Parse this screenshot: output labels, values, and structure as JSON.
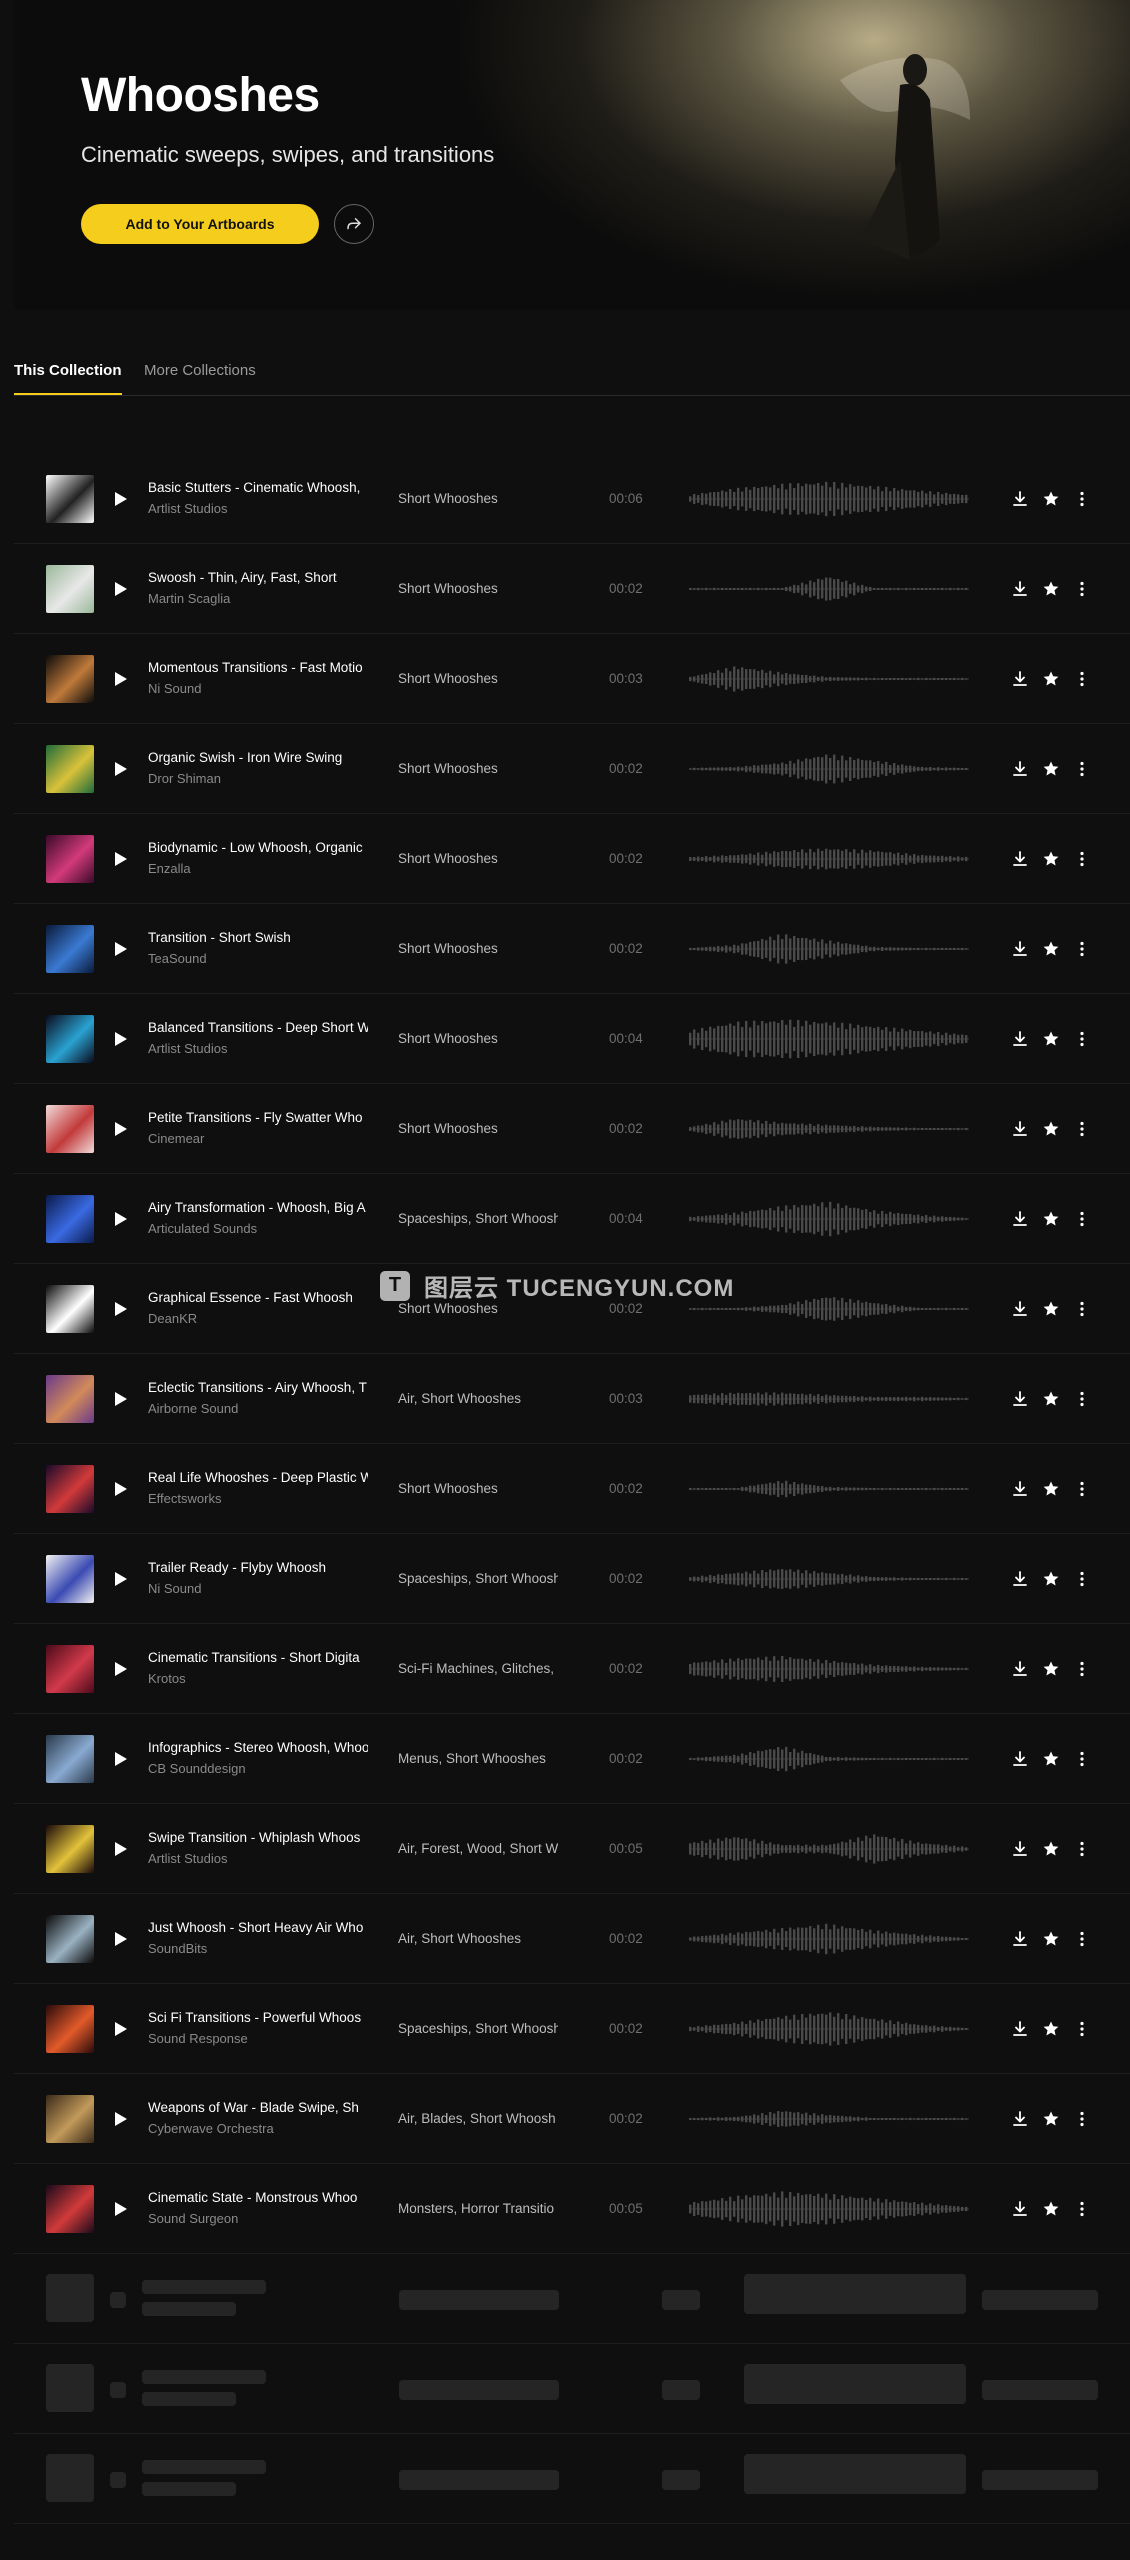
{
  "hero": {
    "title": "Whooshes",
    "subtitle": "Cinematic sweeps, swipes, and transitions",
    "add_button": "Add to Your Artboards",
    "share_icon": "share-icon"
  },
  "tabs": [
    {
      "label": "This Collection",
      "active": true
    },
    {
      "label": "More Collections",
      "active": false
    }
  ],
  "colors": {
    "accent": "#f5cd1d",
    "background": "#0f0f10"
  },
  "watermark": {
    "text": "图层云  TUCENGYUN.COM"
  },
  "tracks": [
    {
      "title": "Basic Stutters - Cinematic Whoosh, ",
      "artist": "Artlist Studios",
      "tags": "Short Whooshes",
      "duration": "00:06",
      "thumb": [
        "#ffffff",
        "#222222"
      ],
      "wave": [
        0.2,
        0.5,
        0.7,
        0.8,
        0.6,
        0.4,
        0.2
      ]
    },
    {
      "title": "Swoosh - Thin, Airy, Fast, Short",
      "artist": "Martin Scaglia",
      "tags": "Short Whooshes",
      "duration": "00:02",
      "thumb": [
        "#9ab79a",
        "#e8e8e8"
      ],
      "wave": [
        0.05,
        0.05,
        0.05,
        0.6,
        0.05,
        0.05,
        0.05
      ]
    },
    {
      "title": "Momentous Transitions - Fast Motio",
      "artist": "Ni Sound",
      "tags": "Short Whooshes",
      "duration": "00:03",
      "thumb": [
        "#0b0b0b",
        "#c07a3a"
      ],
      "wave": [
        0.1,
        0.6,
        0.3,
        0.1,
        0.05,
        0.05,
        0.05
      ]
    },
    {
      "title": "Organic Swish - Iron Wire Swing",
      "artist": "Dror Shiman",
      "tags": "Short Whooshes",
      "duration": "00:02",
      "thumb": [
        "#1f6b3a",
        "#d9c23a"
      ],
      "wave": [
        0.05,
        0.1,
        0.3,
        0.7,
        0.4,
        0.1,
        0.05
      ]
    },
    {
      "title": "Biodynamic - Low Whoosh, Organic",
      "artist": "Enzalla",
      "tags": "Short Whooshes",
      "duration": "00:02",
      "thumb": [
        "#3a0a2a",
        "#d23a7a"
      ],
      "wave": [
        0.1,
        0.2,
        0.4,
        0.5,
        0.4,
        0.2,
        0.1
      ]
    },
    {
      "title": "Transition - Short Swish",
      "artist": "TeaSound",
      "tags": "Short Whooshes",
      "duration": "00:02",
      "thumb": [
        "#0a1a3a",
        "#3a7ad2"
      ],
      "wave": [
        0.05,
        0.2,
        0.7,
        0.4,
        0.1,
        0.05,
        0.05
      ]
    },
    {
      "title": "Balanced Transitions - Deep Short W",
      "artist": "Artlist Studios",
      "tags": "Short Whooshes",
      "duration": "00:04",
      "thumb": [
        "#0a0a1a",
        "#2aa2d2"
      ],
      "wave": [
        0.4,
        0.8,
        0.9,
        0.8,
        0.6,
        0.4,
        0.2
      ]
    },
    {
      "title": "Petite Transitions - Fly Swatter Who",
      "artist": "Cinemear",
      "tags": "Short Whooshes",
      "duration": "00:02",
      "thumb": [
        "#f2dada",
        "#c23a3a"
      ],
      "wave": [
        0.1,
        0.5,
        0.3,
        0.2,
        0.1,
        0.05,
        0.05
      ]
    },
    {
      "title": "Airy Transformation - Whoosh, Big A",
      "artist": "Articulated Sounds",
      "tags": "Spaceships, Short Whoosh",
      "duration": "00:04",
      "thumb": [
        "#0a1a4a",
        "#3a6ae2"
      ],
      "wave": [
        0.1,
        0.3,
        0.6,
        0.8,
        0.4,
        0.2,
        0.05
      ]
    },
    {
      "title": "Graphical Essence - Fast Whoosh",
      "artist": "DeanKR",
      "tags": "Short Whooshes",
      "duration": "00:02",
      "thumb": [
        "#0a0a0a",
        "#ffffff"
      ],
      "wave": [
        0.05,
        0.05,
        0.2,
        0.6,
        0.3,
        0.05,
        0.05
      ]
    },
    {
      "title": "Eclectic Transitions - Airy Whoosh, T",
      "artist": "Airborne Sound",
      "tags": "Air, Short Whooshes",
      "duration": "00:03",
      "thumb": [
        "#6a3a8a",
        "#d28a5a"
      ],
      "wave": [
        0.2,
        0.3,
        0.3,
        0.2,
        0.1,
        0.1,
        0.05
      ]
    },
    {
      "title": "Real Life Whooshes - Deep Plastic W",
      "artist": "Effectsworks",
      "tags": "Short Whooshes",
      "duration": "00:02",
      "thumb": [
        "#1a0a2a",
        "#d23a3a"
      ],
      "wave": [
        0.05,
        0.05,
        0.4,
        0.1,
        0.05,
        0.05,
        0.05
      ]
    },
    {
      "title": "Trailer Ready - Flyby Whoosh",
      "artist": "Ni Sound",
      "tags": "Spaceships, Short Whoosh",
      "duration": "00:02",
      "thumb": [
        "#f2f2f2",
        "#3a4ab2"
      ],
      "wave": [
        0.1,
        0.3,
        0.5,
        0.3,
        0.1,
        0.05,
        0.05
      ]
    },
    {
      "title": "Cinematic Transitions - Short Digita",
      "artist": "Krotos",
      "tags": "Sci-Fi Machines, Glitches,",
      "duration": "00:02",
      "thumb": [
        "#4a0a1a",
        "#d23a4a"
      ],
      "wave": [
        0.3,
        0.5,
        0.6,
        0.4,
        0.2,
        0.1,
        0.05
      ]
    },
    {
      "title": "Infographics - Stereo Whoosh, Whoo",
      "artist": "CB Sounddesign",
      "tags": "Menus, Short Whooshes",
      "duration": "00:02",
      "thumb": [
        "#2a3a4a",
        "#8aaad2"
      ],
      "wave": [
        0.05,
        0.2,
        0.6,
        0.1,
        0.05,
        0.05,
        0.05
      ]
    },
    {
      "title": "Swipe Transition - Whiplash Whoos",
      "artist": "Artlist Studios",
      "tags": "Air, Forest, Wood, Short W",
      "duration": "00:05",
      "thumb": [
        "#1a0a0a",
        "#e2c23a"
      ],
      "wave": [
        0.3,
        0.6,
        0.2,
        0.2,
        0.7,
        0.3,
        0.1
      ]
    },
    {
      "title": "Just Whoosh - Short Heavy Air Who",
      "artist": "SoundBits",
      "tags": "Air, Short Whooshes",
      "duration": "00:02",
      "thumb": [
        "#0a0a0a",
        "#9ab2c2"
      ],
      "wave": [
        0.1,
        0.3,
        0.5,
        0.7,
        0.4,
        0.2,
        0.05
      ]
    },
    {
      "title": "Sci Fi Transitions - Powerful Whoos",
      "artist": "Sound Response",
      "tags": "Spaceships, Short Whoosh",
      "duration": "00:02",
      "thumb": [
        "#2a0a0a",
        "#e25a2a"
      ],
      "wave": [
        0.1,
        0.3,
        0.6,
        0.8,
        0.5,
        0.2,
        0.05
      ]
    },
    {
      "title": "Weapons of War - Blade Swipe, Sh",
      "artist": "Cyberwave Orchestra",
      "tags": "Air, Blades, Short Whoosh",
      "duration": "00:02",
      "thumb": [
        "#3a2a1a",
        "#c29a5a"
      ],
      "wave": [
        0.05,
        0.1,
        0.4,
        0.2,
        0.05,
        0.05,
        0.05
      ]
    },
    {
      "title": "Cinematic State - Monstrous Whoo",
      "artist": "Sound Surgeon",
      "tags": "Monsters, Horror Transitio",
      "duration": "00:05",
      "thumb": [
        "#1a0a1a",
        "#d23a3a"
      ],
      "wave": [
        0.3,
        0.6,
        0.8,
        0.7,
        0.5,
        0.3,
        0.1
      ]
    }
  ],
  "skeleton_rows": 3
}
